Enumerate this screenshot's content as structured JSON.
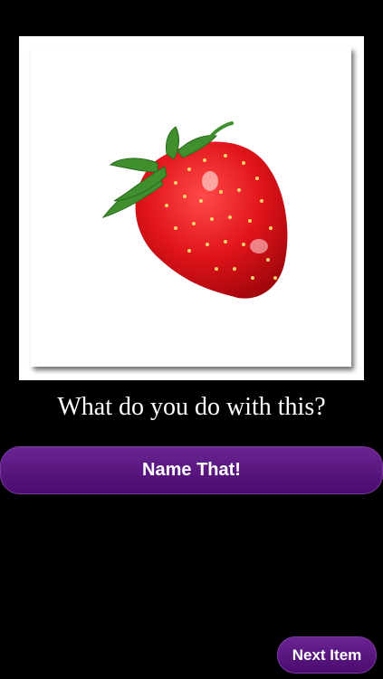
{
  "image": {
    "subject_icon": "strawberry-image"
  },
  "prompt": {
    "question": "What do you do with this?"
  },
  "actions": {
    "name_that_label": "Name That!",
    "next_item_label": "Next Item"
  },
  "colors": {
    "background": "#000000",
    "button_purple": "#5a1480",
    "text": "#ffffff"
  }
}
